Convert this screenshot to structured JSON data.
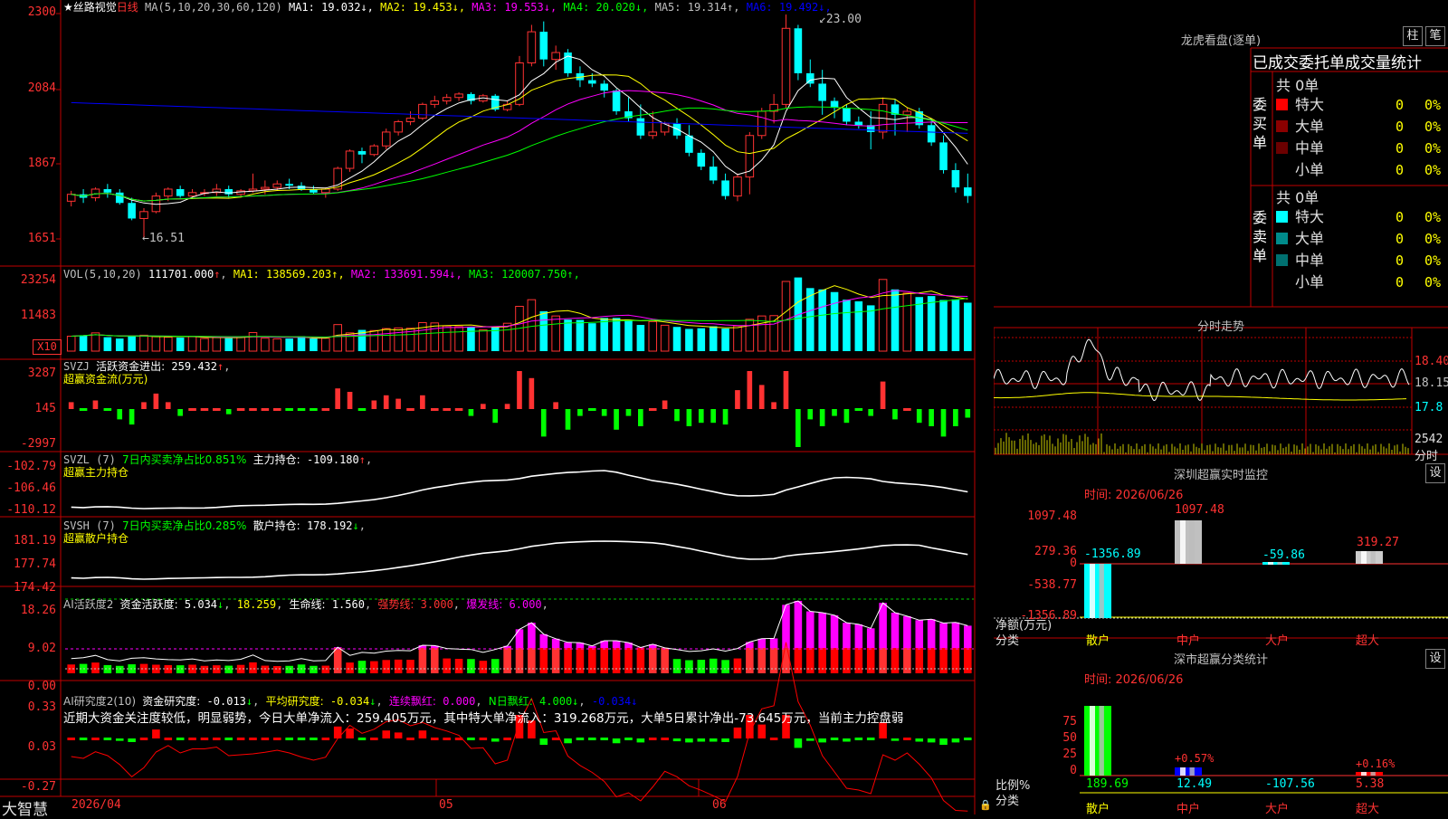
{
  "main": {
    "stock_name": "★丝路视觉",
    "period": "日线",
    "ma_label": "MA(5,10,20,30,60,120)",
    "ma": [
      {
        "label": "MA1:",
        "value": "19.032",
        "arrow": "↓",
        "color": "#ffffff"
      },
      {
        "label": "MA2:",
        "value": "19.453",
        "arrow": "↓",
        "color": "#ffff00"
      },
      {
        "label": "MA3:",
        "value": "19.553",
        "arrow": "↓",
        "color": "#ff00ff"
      },
      {
        "label": "MA4:",
        "value": "20.020",
        "arrow": "↓",
        "color": "#00ff00"
      },
      {
        "label": "MA5:",
        "value": "19.314",
        "arrow": "↑",
        "color": "#c0c0c0"
      },
      {
        "label": "MA6:",
        "value": "19.492",
        "arrow": "↓",
        "color": "#0000ff"
      }
    ],
    "high_label": "23.00",
    "low_label": "16.51",
    "ticks": [
      "2300",
      "2084",
      "1867",
      "1651"
    ]
  },
  "vol": {
    "header": "VOL(5,10,20)",
    "value": "111701.000",
    "ma": [
      {
        "label": "MA1:",
        "value": "138569.203",
        "arrow": "↑",
        "color": "#ffff00"
      },
      {
        "label": "MA2:",
        "value": "133691.594",
        "arrow": "↓",
        "color": "#ff00ff"
      },
      {
        "label": "MA3:",
        "value": "120007.750",
        "arrow": "↑",
        "color": "#00ff00"
      }
    ],
    "ticks": [
      "23254",
      "11483"
    ],
    "unit": "X10"
  },
  "svzj": {
    "header": "SVZJ",
    "label": "活跃资金进出:",
    "value": "259.432",
    "arrow": "↑",
    "sub": "超赢资金流(万元)",
    "ticks": [
      "3287",
      "145",
      "-2997"
    ]
  },
  "svzl": {
    "header": "SVZL (7)",
    "ratio": "7日内买卖净占比0.851%",
    "label": "主力持仓:",
    "value": "-109.180",
    "arrow": "↑",
    "sub": "超赢主力持仓",
    "ticks": [
      "-102.79",
      "-106.46",
      "-110.12"
    ]
  },
  "svsh": {
    "header": "SVSH (7)",
    "ratio": "7日内买卖净占比0.285%",
    "label": "散户持仓:",
    "value": "178.192",
    "arrow": "↓",
    "sub": "超赢散户持仓",
    "ticks": [
      "181.19",
      "177.74",
      "174.42"
    ]
  },
  "ai1": {
    "header": "AI活跃度2",
    "label1": "资金活跃度:",
    "v1": "5.034",
    "a1": "↓",
    "v2": "18.259",
    "label3": "生命线:",
    "v3": "1.560",
    "label4": "强势线:",
    "v4": "3.000",
    "label5": "爆发线:",
    "v5": "6.000",
    "ticks": [
      "18.26",
      "9.02",
      "0.00"
    ]
  },
  "ai2": {
    "header": "AI研究度2(10)",
    "label1": "资金研究度:",
    "v1": "-0.013",
    "a1": "↓",
    "label2": "平均研究度:",
    "v2": "-0.034",
    "a2": "↓",
    "label3": "连续飘红:",
    "v3": "0.000",
    "label4": "N日飘红:",
    "v4": "4.000",
    "a4": "↓",
    "v5": "-0.034",
    "a5": "↓",
    "text": "近期大资金关注度较低，明显弱势，今日大单净流入：259.405万元，其中特大单净流入：319.268万元，大单5日累计净出-73.645万元，当前主力控盘弱",
    "ticks": [
      "0.33",
      "0.03",
      "-0.27"
    ]
  },
  "bottom": {
    "brand": "大智慧",
    "date": "2026/04",
    "m05": "05",
    "m06": "06"
  },
  "lhb": {
    "title": "龙虎看盘(逐单)",
    "btn1": "柱",
    "btn2": "笔",
    "tabs": "已成交委托单成交量统计",
    "buy_label": "委买单",
    "sell_label": "委卖单",
    "buy_total": "共 0单",
    "sell_total": "共 0单",
    "rows_buy": [
      {
        "name": "特大",
        "val": "0",
        "pct": "0%",
        "color": "#ff0000"
      },
      {
        "name": "大单",
        "val": "0",
        "pct": "0%",
        "color": "#8b0000"
      },
      {
        "name": "中单",
        "val": "0",
        "pct": "0%",
        "color": "#6b0000"
      },
      {
        "name": "小单",
        "val": "0",
        "pct": "0%",
        "color": ""
      }
    ],
    "rows_sell": [
      {
        "name": "特大",
        "val": "0",
        "pct": "0%",
        "color": "#00ffff"
      },
      {
        "name": "大单",
        "val": "0",
        "pct": "0%",
        "color": "#008b8b"
      },
      {
        "name": "中单",
        "val": "0",
        "pct": "0%",
        "color": "#007070"
      },
      {
        "name": "小单",
        "val": "0",
        "pct": "0%",
        "color": ""
      }
    ]
  },
  "fenshi": {
    "title": "分时走势",
    "ticks": [
      "18.40",
      "18.15",
      "17.8"
    ],
    "vol_tick": "2542",
    "vol_unit": "分时"
  },
  "sz_monitor": {
    "title": "深圳超赢实时监控",
    "btn": "设",
    "time": "时间: 2026/06/26",
    "ticks": [
      "1097.48",
      "279.36",
      "0",
      "-538.77",
      "-1356.89"
    ],
    "net_label": "净额(万元)",
    "cat_label": "分类",
    "cats": [
      "散户",
      "中户",
      "大户",
      "超大"
    ],
    "bar_values": [
      "-1356.89",
      "1097.48",
      "-59.86",
      "319.27"
    ]
  },
  "sz_class": {
    "title": "深市超赢分类统计",
    "btn": "设",
    "time": "时间: 2026/06/26",
    "ticks": [
      "75",
      "50",
      "25",
      "0"
    ],
    "ratio_label": "比例%",
    "cat_label": "分类",
    "cats": [
      "散户",
      "中户",
      "大户",
      "超大"
    ],
    "values": [
      "189.69",
      "12.49",
      "-107.56",
      "5.38"
    ],
    "pcts": [
      "+0.57%",
      "+0.16%"
    ]
  },
  "chart_data": [
    {
      "type": "candlestick",
      "title": "丝路视觉 日线",
      "ylim": [
        16.0,
        23.3
      ],
      "x": [
        "2026/04",
        "05",
        "06"
      ],
      "ohlc": [
        [
          17.6,
          17.9,
          17.45,
          17.8
        ],
        [
          17.8,
          17.95,
          17.55,
          17.7
        ],
        [
          17.7,
          18.0,
          17.6,
          17.95
        ],
        [
          17.95,
          18.1,
          17.7,
          17.85
        ],
        [
          17.85,
          17.95,
          17.5,
          17.55
        ],
        [
          17.55,
          17.7,
          17.05,
          17.1
        ],
        [
          17.1,
          17.4,
          16.51,
          17.3
        ],
        [
          17.3,
          17.85,
          17.25,
          17.75
        ],
        [
          17.75,
          18.0,
          17.6,
          17.95
        ],
        [
          17.95,
          18.05,
          17.7,
          17.75
        ],
        [
          17.75,
          17.95,
          17.7,
          17.85
        ],
        [
          17.85,
          17.95,
          17.75,
          17.85
        ],
        [
          17.85,
          18.1,
          17.75,
          17.95
        ],
        [
          17.95,
          18.05,
          17.7,
          17.8
        ],
        [
          17.8,
          17.95,
          17.7,
          17.9
        ],
        [
          17.9,
          18.4,
          17.85,
          17.95
        ],
        [
          17.95,
          18.2,
          17.8,
          18.0
        ],
        [
          18.0,
          18.2,
          17.9,
          18.1
        ],
        [
          18.1,
          18.25,
          17.95,
          18.05
        ],
        [
          18.05,
          18.15,
          17.9,
          17.95
        ],
        [
          17.95,
          18.05,
          17.8,
          17.85
        ],
        [
          17.85,
          18.0,
          17.7,
          17.95
        ],
        [
          17.95,
          18.6,
          17.9,
          18.55
        ],
        [
          18.55,
          19.1,
          18.45,
          19.05
        ],
        [
          19.05,
          19.15,
          18.7,
          18.95
        ],
        [
          18.95,
          19.25,
          18.9,
          19.2
        ],
        [
          19.2,
          19.7,
          19.1,
          19.6
        ],
        [
          19.6,
          19.95,
          19.5,
          19.9
        ],
        [
          19.9,
          20.2,
          19.8,
          20.0
        ],
        [
          20.0,
          20.45,
          19.95,
          20.4
        ],
        [
          20.4,
          20.65,
          20.3,
          20.5
        ],
        [
          20.5,
          20.7,
          20.4,
          20.6
        ],
        [
          20.6,
          20.75,
          20.5,
          20.7
        ],
        [
          20.7,
          20.75,
          20.4,
          20.5
        ],
        [
          20.5,
          20.7,
          20.45,
          20.65
        ],
        [
          20.65,
          20.7,
          20.2,
          20.25
        ],
        [
          20.25,
          20.5,
          20.2,
          20.4
        ],
        [
          20.4,
          21.8,
          20.35,
          21.6
        ],
        [
          21.6,
          22.7,
          21.5,
          22.5
        ],
        [
          22.5,
          22.8,
          21.5,
          21.7
        ],
        [
          21.7,
          22.1,
          21.4,
          21.9
        ],
        [
          21.9,
          22.0,
          21.2,
          21.3
        ],
        [
          21.3,
          21.5,
          20.9,
          21.1
        ],
        [
          21.1,
          21.3,
          20.9,
          21.0
        ],
        [
          21.0,
          21.1,
          20.6,
          20.8
        ],
        [
          20.8,
          20.85,
          20.1,
          20.2
        ],
        [
          20.2,
          20.6,
          19.9,
          20.0
        ],
        [
          20.0,
          20.4,
          19.4,
          19.5
        ],
        [
          19.5,
          20.2,
          19.4,
          19.6
        ],
        [
          19.6,
          19.9,
          19.5,
          19.85
        ],
        [
          19.85,
          20.0,
          19.4,
          19.5
        ],
        [
          19.5,
          19.8,
          18.9,
          19.0
        ],
        [
          19.0,
          19.1,
          18.5,
          18.6
        ],
        [
          18.6,
          18.9,
          18.1,
          18.2
        ],
        [
          18.2,
          18.4,
          17.65,
          17.75
        ],
        [
          17.75,
          18.4,
          17.6,
          18.3
        ],
        [
          18.3,
          19.6,
          17.8,
          19.5
        ],
        [
          19.5,
          20.3,
          19.4,
          20.2
        ],
        [
          20.2,
          20.7,
          19.85,
          20.4
        ],
        [
          20.4,
          23.0,
          20.3,
          22.6
        ],
        [
          22.6,
          22.7,
          21.1,
          21.3
        ],
        [
          21.3,
          21.7,
          20.9,
          21.0
        ],
        [
          21.0,
          21.4,
          20.1,
          20.5
        ],
        [
          20.5,
          20.6,
          20.0,
          20.3
        ],
        [
          20.3,
          20.4,
          19.8,
          19.9
        ],
        [
          19.9,
          20.05,
          19.7,
          19.8
        ],
        [
          19.8,
          20.2,
          19.1,
          19.6
        ],
        [
          19.6,
          20.6,
          19.4,
          20.4
        ],
        [
          20.4,
          20.55,
          19.5,
          20.1
        ],
        [
          20.1,
          20.3,
          19.6,
          20.2
        ],
        [
          20.2,
          20.3,
          19.7,
          19.8
        ],
        [
          19.8,
          20.0,
          19.2,
          19.3
        ],
        [
          19.3,
          19.5,
          18.4,
          18.5
        ],
        [
          18.5,
          18.7,
          17.85,
          18.0
        ],
        [
          18.0,
          18.4,
          17.55,
          17.75
        ]
      ],
      "volume": [
        4500,
        4800,
        5500,
        4200,
        3800,
        4600,
        4800,
        4400,
        4200,
        4100,
        4400,
        3800,
        4100,
        3900,
        4300,
        5600,
        3900,
        3700,
        3800,
        4500,
        3800,
        3900,
        8000,
        5500,
        6400,
        6200,
        6800,
        7000,
        6900,
        8600,
        8500,
        7600,
        7400,
        7300,
        6400,
        7300,
        8400,
        13500,
        15500,
        12000,
        10600,
        9500,
        9400,
        8400,
        10000,
        10000,
        9400,
        7900,
        8900,
        7800,
        7300,
        6700,
        6900,
        7500,
        6800,
        7600,
        9600,
        10600,
        10700,
        21000,
        22200,
        19000,
        18600,
        17800,
        15500,
        15000,
        13800,
        21600,
        18600,
        17500,
        16300,
        16600,
        15400,
        15600,
        14600
      ]
    }
  ]
}
